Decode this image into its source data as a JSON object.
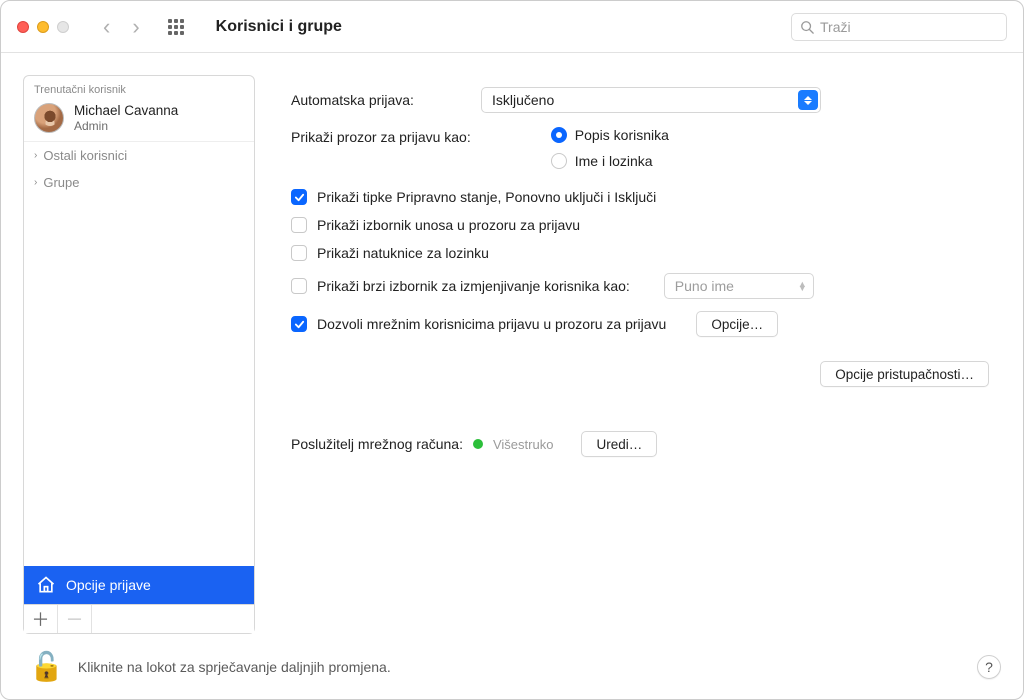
{
  "titlebar": {
    "title": "Korisnici i grupe",
    "search_placeholder": "Traži"
  },
  "sidebar": {
    "current_label": "Trenutačni korisnik",
    "user_name": "Michael Cavanna",
    "user_role": "Admin",
    "others_label": "Ostali korisnici",
    "groups_label": "Grupe",
    "login_options_label": "Opcije prijave"
  },
  "panel": {
    "auto_login_label": "Automatska prijava:",
    "auto_login_value": "Isključeno",
    "login_window_label": "Prikaži prozor za prijavu kao:",
    "radio_list": "Popis korisnika",
    "radio_name_pass": "Ime i lozinka",
    "check_sleep": "Prikaži tipke Pripravno stanje, Ponovno uključi i Isključi",
    "check_input_menu": "Prikaži izbornik unosa u prozoru za prijavu",
    "check_hints": "Prikaži natuknice za lozinku",
    "check_fast_switch": "Prikaži brzi izbornik za izmjenjivanje korisnika kao:",
    "fast_switch_select": "Puno ime",
    "check_network_users": "Dozvoli mrežnim korisnicima prijavu u prozoru za prijavu",
    "network_options_btn": "Opcije…",
    "accessibility_btn": "Opcije pristupačnosti…",
    "net_server_label": "Poslužitelj mrežnog računa:",
    "net_status_text": "Višestruko",
    "edit_btn": "Uredi…"
  },
  "footer": {
    "lock_text": "Kliknite na lokot za sprječavanje daljnjih promjena."
  }
}
